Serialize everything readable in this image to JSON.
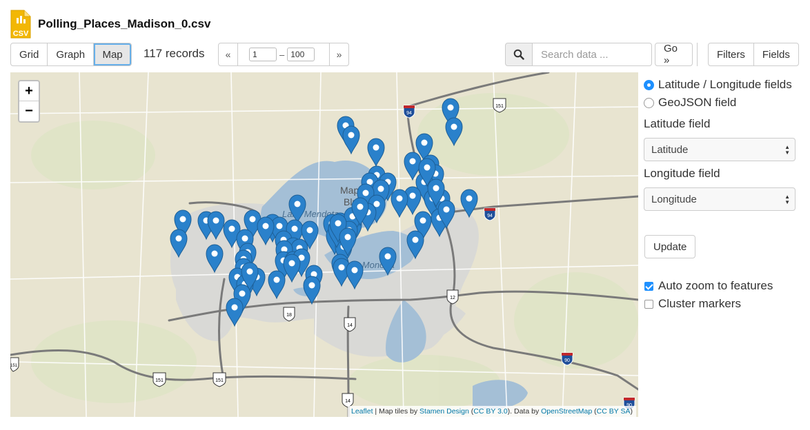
{
  "file": {
    "name": "Polling_Places_Madison_0.csv",
    "icon": "csv-file-icon",
    "icon_text": "CSV"
  },
  "toolbar": {
    "views": [
      {
        "label": "Grid",
        "active": false
      },
      {
        "label": "Graph",
        "active": false
      },
      {
        "label": "Map",
        "active": true
      }
    ],
    "record_count": "117 records",
    "pager": {
      "prev": "«",
      "next": "»",
      "from": "1",
      "to": "100",
      "separator": "–"
    },
    "search": {
      "placeholder": "Search data ...",
      "value": ""
    },
    "go_label": "Go »",
    "filters_label": "Filters",
    "fields_label": "Fields"
  },
  "map": {
    "zoom_in": "+",
    "zoom_out": "−",
    "labels": {
      "lake_mendota": "Lake Mendota",
      "lake_monona": "Lake Monona",
      "maple_bluff_1": "Maple",
      "maple_bluff_2": "Bluff"
    },
    "shields": {
      "i94": "94",
      "i90": "90",
      "us151": "151",
      "us18": "18",
      "us14": "14",
      "us12": "12"
    },
    "marker_count": 117,
    "attribution": {
      "leaflet": "Leaflet",
      "sep1": " | Map tiles by ",
      "stamen": "Stamen Design",
      "open1": " (",
      "cc_by": "CC BY 3.0",
      "close1": "). Data by ",
      "osm": "OpenStreetMap",
      "open2": " (",
      "cc_by_sa": "CC BY SA",
      "close2": ")"
    },
    "colors": {
      "land": "#e8e4d0",
      "water": "#a4bfd6",
      "urban": "#d9d9d6",
      "marker": "#2a81cb",
      "road": "#6b6b6b"
    }
  },
  "panel": {
    "radio_latlon": "Latitude / Longitude fields",
    "radio_geojson": "GeoJSON field",
    "lat_label": "Latitude field",
    "lat_value": "Latitude",
    "lon_label": "Longitude field",
    "lon_value": "Longitude",
    "update_label": "Update",
    "auto_zoom_label": "Auto zoom to features",
    "auto_zoom_checked": true,
    "cluster_label": "Cluster markers",
    "cluster_checked": false
  }
}
